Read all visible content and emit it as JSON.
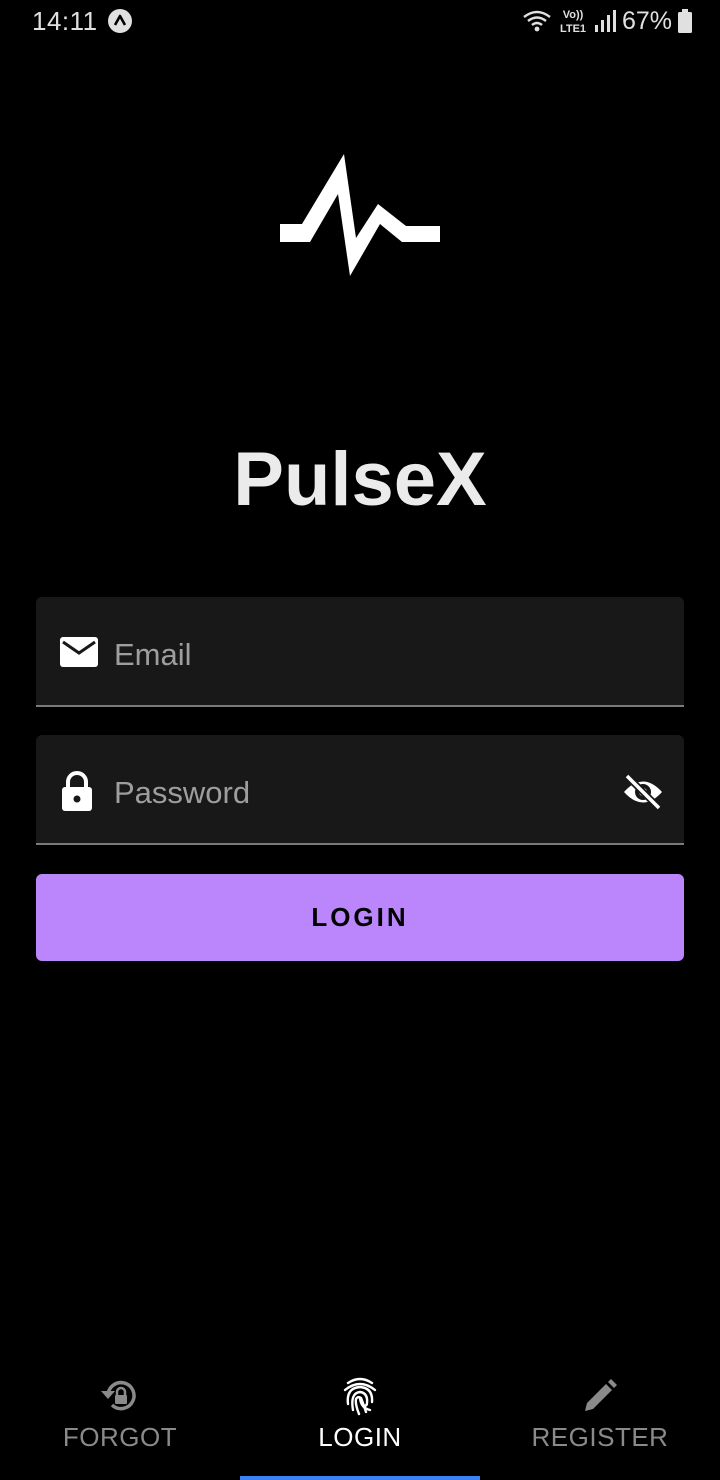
{
  "status_bar": {
    "time": "14:11",
    "battery_percent": "67%",
    "network_label_top": "Vo))",
    "network_label_bottom": "LTE1",
    "icons": [
      "app-notification-icon",
      "wifi-icon",
      "volte-icon",
      "signal-icon",
      "battery-icon"
    ]
  },
  "app": {
    "logo_icon": "pulse-logo-icon",
    "title": "PulseX"
  },
  "form": {
    "email": {
      "placeholder": "Email",
      "value": "",
      "icon": "email-icon"
    },
    "password": {
      "placeholder": "Password",
      "value": "",
      "icon": "lock-icon",
      "toggle_icon": "visibility-off-icon"
    },
    "login_button_label": "LOGIN"
  },
  "bottom_nav": {
    "items": [
      {
        "label": "FORGOT",
        "icon": "lock-reset-icon",
        "active": false
      },
      {
        "label": "LOGIN",
        "icon": "fingerprint-icon",
        "active": true
      },
      {
        "label": "REGISTER",
        "icon": "pencil-icon",
        "active": false
      }
    ]
  },
  "colors": {
    "background": "#000000",
    "field_background": "#181818",
    "accent": "#bb86fc",
    "nav_indicator": "#3b82f6",
    "inactive_text": "#8a8a8a"
  }
}
